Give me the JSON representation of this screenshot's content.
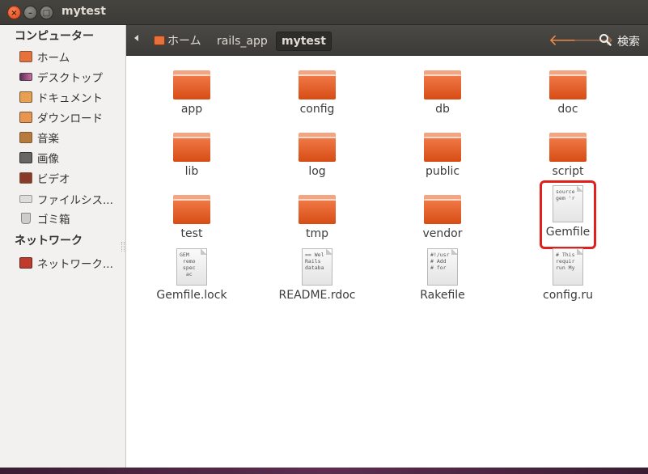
{
  "window": {
    "title": "mytest",
    "close_glyph": "×",
    "min_glyph": "–",
    "max_glyph": "□"
  },
  "sidebar": {
    "sections": [
      {
        "heading": "コンピューター",
        "items": [
          {
            "label": "ホーム",
            "icon": "home-folder-icon"
          },
          {
            "label": "デスクトップ",
            "icon": "desktop-icon"
          },
          {
            "label": "ドキュメント",
            "icon": "documents-folder-icon"
          },
          {
            "label": "ダウンロード",
            "icon": "downloads-folder-icon"
          },
          {
            "label": "音楽",
            "icon": "music-folder-icon"
          },
          {
            "label": "画像",
            "icon": "pictures-folder-icon"
          },
          {
            "label": "ビデオ",
            "icon": "videos-folder-icon"
          },
          {
            "label": "ファイルシス...",
            "icon": "filesystem-icon"
          },
          {
            "label": "ゴミ箱",
            "icon": "trash-icon"
          }
        ]
      },
      {
        "heading": "ネットワーク",
        "items": [
          {
            "label": "ネットワーク...",
            "icon": "network-icon"
          }
        ]
      }
    ]
  },
  "toolbar": {
    "breadcrumbs": [
      "ホーム",
      "rails_app",
      "mytest"
    ],
    "active_crumb": "mytest",
    "back_glyph": "🡐",
    "forward_glyph": "🡒",
    "search_label": "検索"
  },
  "files": [
    {
      "name": "app",
      "type": "folder"
    },
    {
      "name": "config",
      "type": "folder"
    },
    {
      "name": "db",
      "type": "folder"
    },
    {
      "name": "doc",
      "type": "folder"
    },
    {
      "name": "lib",
      "type": "folder"
    },
    {
      "name": "log",
      "type": "folder"
    },
    {
      "name": "public",
      "type": "folder"
    },
    {
      "name": "script",
      "type": "folder"
    },
    {
      "name": "test",
      "type": "folder"
    },
    {
      "name": "tmp",
      "type": "folder"
    },
    {
      "name": "vendor",
      "type": "folder"
    },
    {
      "name": "Gemfile",
      "type": "text",
      "preview": [
        "source",
        "",
        "gem 'r",
        ""
      ],
      "selected": true
    },
    {
      "name": "Gemfile.lock",
      "type": "text",
      "preview": [
        "GEM",
        " remo",
        " spec",
        "  ac"
      ]
    },
    {
      "name": "README.rdoc",
      "type": "text",
      "preview": [
        "== Wel",
        "",
        "Rails",
        "databa"
      ]
    },
    {
      "name": "Rakefile",
      "type": "text",
      "preview": [
        "#!/usr",
        "# Add",
        "# for",
        ""
      ]
    },
    {
      "name": "config.ru",
      "type": "text",
      "preview": [
        "# This",
        "",
        "requir",
        "run My"
      ]
    }
  ],
  "colors": {
    "accent_orange": "#dd4814",
    "selection_outline": "#e0201c",
    "titlebar": "#3c3b37"
  }
}
